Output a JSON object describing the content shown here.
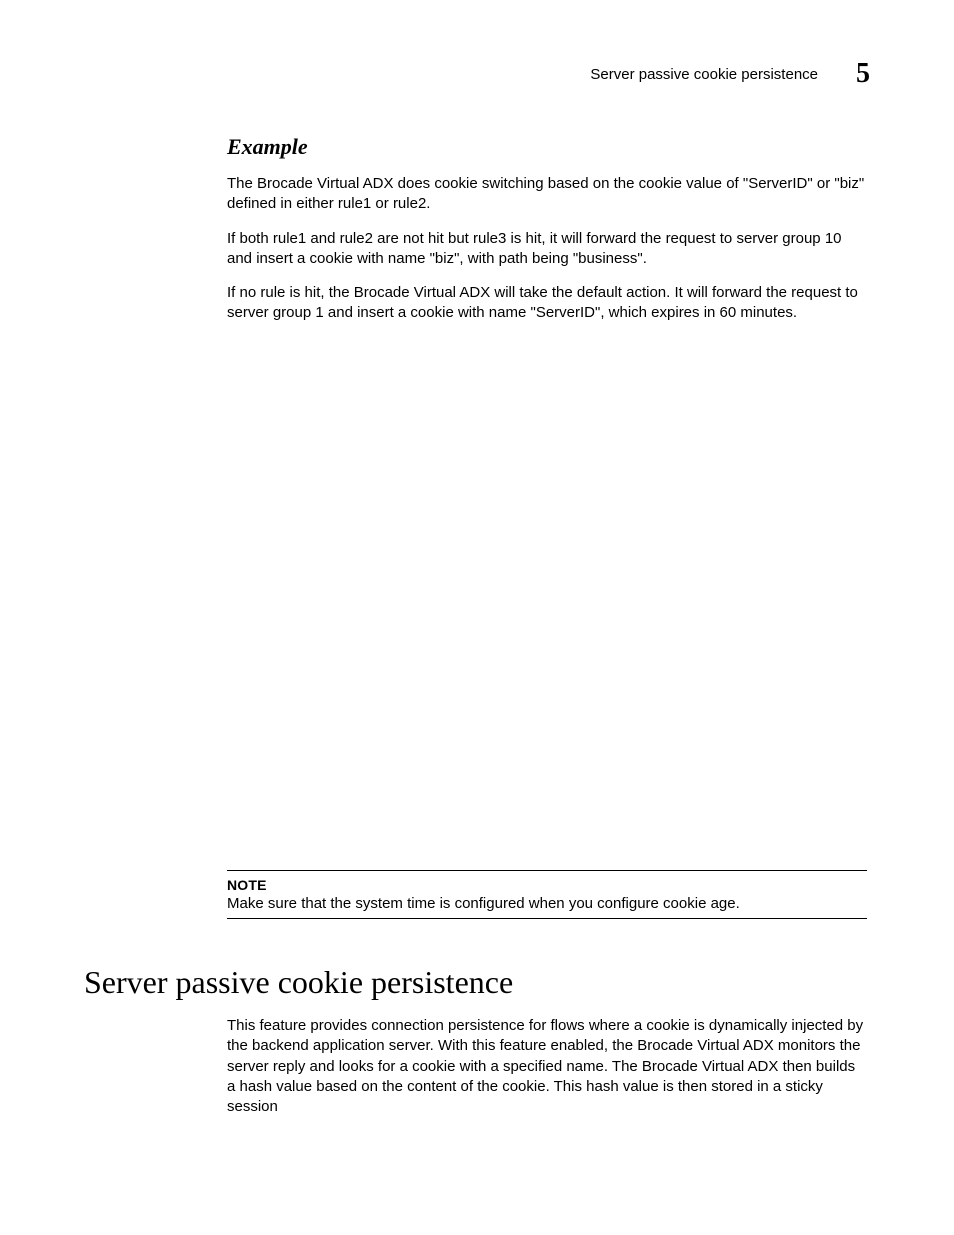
{
  "header": {
    "running_title": "Server passive cookie persistence",
    "chapter_number": "5"
  },
  "example": {
    "heading": "Example",
    "p1": "The Brocade Virtual ADX does cookie switching based on the cookie value of \"ServerID\" or \"biz\" defined in either rule1 or rule2.",
    "p2": "If both rule1 and rule2 are not hit but rule3 is hit, it will forward the request to server group 10 and insert a cookie with name \"biz\", with path being \"business\".",
    "p3": "If no rule is hit, the Brocade Virtual ADX will take the default action. It will forward the request to server group 1 and insert a cookie with name \"ServerID\", which expires in 60 minutes."
  },
  "note": {
    "label": "NOTE",
    "text": "Make sure that the system time is configured when you configure cookie age."
  },
  "section": {
    "heading": "Server passive cookie persistence",
    "p1": "This feature provides connection persistence for flows where a cookie is dynamically injected by the backend application server. With this feature enabled, the Brocade Virtual ADX monitors the server reply and looks for a cookie with a specified name. The Brocade Virtual ADX then builds a hash value based on the content of the cookie. This hash value is then stored in a sticky session"
  }
}
